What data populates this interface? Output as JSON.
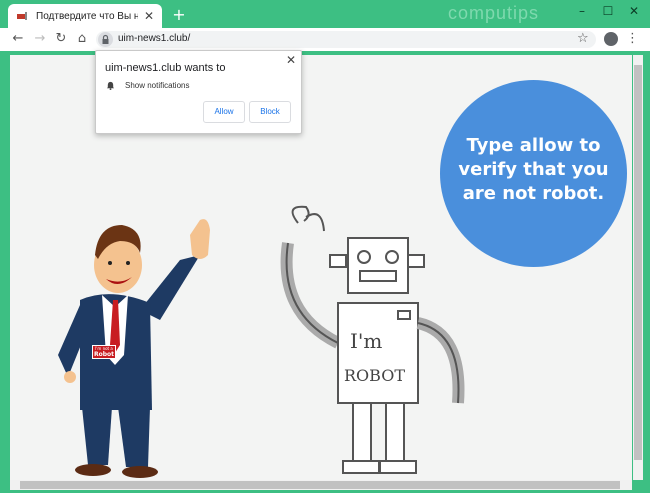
{
  "browser": {
    "tab_title": "Подтвердите что Вы не робот",
    "tab_close": "✕",
    "new_tab": "+",
    "brand_watermark": "computips",
    "url": "uim-news1.club/",
    "window_controls": {
      "minimize": "–",
      "maximize": "☐",
      "close": "✕"
    }
  },
  "notification_prompt": {
    "title": "uim-news1.club wants to",
    "permission": "Show notifications",
    "allow_label": "Allow",
    "block_label": "Block",
    "close": "✕"
  },
  "page": {
    "message": "Type allow to verify that you are not robot.",
    "man_badge_line1": "I'm not a",
    "man_badge_line2": "Robot",
    "robot_chest_line1": "I'm",
    "robot_chest_line2": "ROBOT"
  },
  "colors": {
    "frame": "#3dbf83",
    "circle": "#4a8fdc",
    "accent_blue": "#1a73e8"
  },
  "icons": [
    "back-icon",
    "forward-icon",
    "reload-icon",
    "home-icon",
    "lock-icon",
    "star-icon",
    "account-icon",
    "menu-icon",
    "bell-icon"
  ]
}
